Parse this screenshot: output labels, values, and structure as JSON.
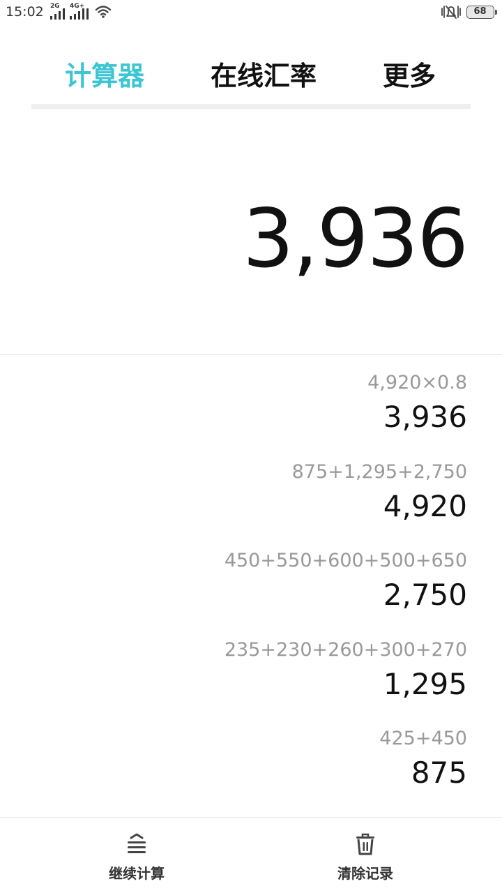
{
  "status_bar": {
    "time": "15:02",
    "signal_1_label": "2G",
    "signal_2_label": "4G+",
    "battery_level": "68",
    "icons": [
      "signal-icon",
      "wifi-icon",
      "vibrate-icon",
      "battery-icon"
    ]
  },
  "tabs": [
    {
      "label": "计算器",
      "active": true
    },
    {
      "label": "在线汇率",
      "active": false
    },
    {
      "label": "更多",
      "active": false
    }
  ],
  "accent_color": "#3cc6d4",
  "display": {
    "result": "3,936"
  },
  "history": [
    {
      "expression": "4,920×0.8",
      "result": "3,936"
    },
    {
      "expression": "875+1,295+2,750",
      "result": "4,920"
    },
    {
      "expression": "450+550+600+500+650",
      "result": "2,750"
    },
    {
      "expression": "235+230+260+300+270",
      "result": "1,295"
    },
    {
      "expression": "425+450",
      "result": "875"
    }
  ],
  "bottom_bar": {
    "continue_label": "继续计算",
    "continue_icon": "list-icon",
    "clear_label": "清除记录",
    "clear_icon": "trash-icon"
  }
}
